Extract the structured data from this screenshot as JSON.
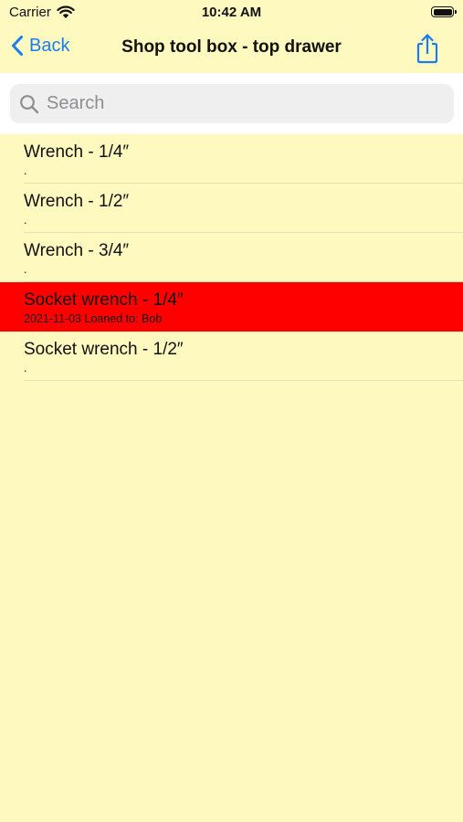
{
  "status_bar": {
    "carrier": "Carrier",
    "time": "10:42 AM"
  },
  "nav": {
    "back_label": "Back",
    "title": "Shop tool box - top drawer",
    "accent_color": "#1a7cf2"
  },
  "search": {
    "placeholder": "Search",
    "value": ""
  },
  "colors": {
    "background": "#fef9bf",
    "highlight": "#ff0000"
  },
  "items": [
    {
      "title": "Wrench - 1/4″",
      "subtitle": "."
    },
    {
      "title": "Wrench - 1/2″",
      "subtitle": "."
    },
    {
      "title": "Wrench - 3/4″",
      "subtitle": "."
    },
    {
      "title": "Socket wrench - 1/4″",
      "subtitle": "2021-11-03 Loaned to: Bob",
      "highlighted": true
    },
    {
      "title": "Socket wrench - 1/2″",
      "subtitle": "."
    }
  ]
}
